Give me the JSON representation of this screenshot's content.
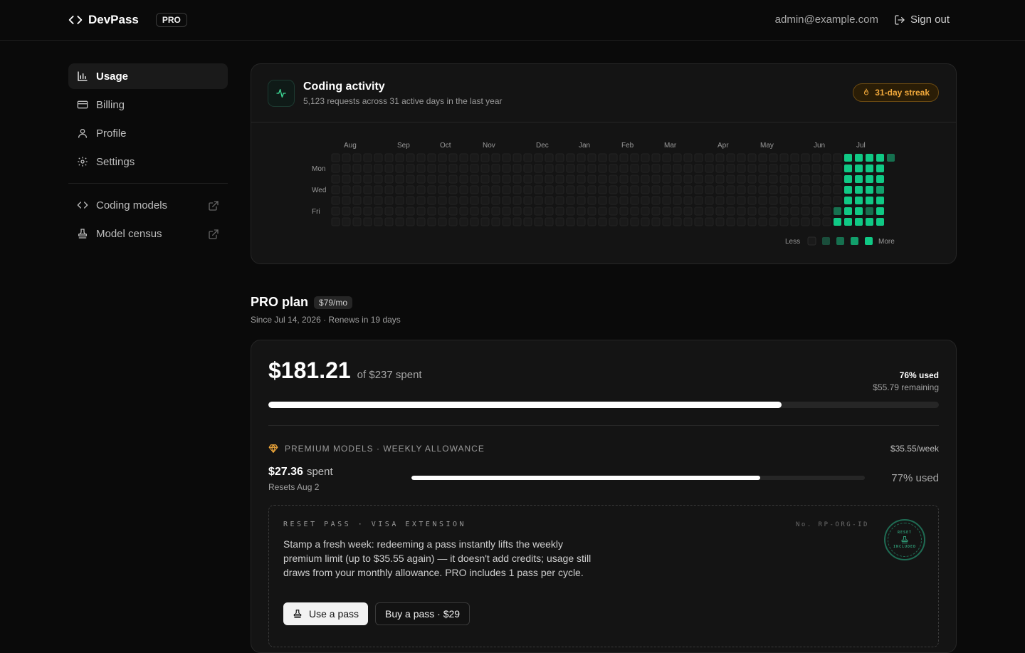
{
  "header": {
    "brand": "DevPass",
    "badge": "PRO",
    "email": "admin@example.com",
    "signout_label": "Sign out"
  },
  "sidebar": {
    "items": [
      {
        "label": "Usage",
        "icon": "bar-chart-icon",
        "active": true
      },
      {
        "label": "Billing",
        "icon": "credit-card-icon"
      },
      {
        "label": "Profile",
        "icon": "user-icon"
      },
      {
        "label": "Settings",
        "icon": "gear-icon"
      }
    ],
    "external": [
      {
        "label": "Coding models",
        "icon": "code-icon"
      },
      {
        "label": "Model census",
        "icon": "stamp-icon"
      }
    ]
  },
  "activity": {
    "title": "Coding activity",
    "subtitle": "5,123 requests across 31 active days in the last year",
    "streak": "31-day streak",
    "months": [
      "Aug",
      "Sep",
      "Oct",
      "Nov",
      "Dec",
      "Jan",
      "Feb",
      "Mar",
      "Apr",
      "May",
      "Jun",
      "Jul"
    ],
    "days": [
      "Mon",
      "Wed",
      "Fri"
    ],
    "legend_less": "Less",
    "legend_more": "More",
    "colors": {
      "empty": "#1a1a1a",
      "l1": "#1a4d3b",
      "l2": "#16704f",
      "l3": "#12a06c",
      "l4": "#10c985",
      "accent": "#3ddc97"
    }
  },
  "plan": {
    "title": "PRO plan",
    "price": "$79/mo",
    "subtitle": "Since Jul 14, 2026 · Renews in 19 days"
  },
  "spend": {
    "amount": "$181.21",
    "of_text": "of $237 spent",
    "used_pct_label": "76% used",
    "remaining": "$55.79 remaining",
    "used_fraction": 0.765
  },
  "premium": {
    "label": "PREMIUM MODELS · WEEKLY ALLOWANCE",
    "rate": "$35.55/week",
    "spent_value": "$27.36",
    "spent_word": "spent",
    "resets": "Resets Aug 2",
    "used_label": "77% used",
    "used_fraction": 0.77
  },
  "pass": {
    "heading": "RESET PASS · VISA EXTENSION",
    "number": "No. RP-ORG-ID",
    "text": "Stamp a fresh week: redeeming a pass instantly lifts the weekly premium limit (up to $35.55 again) — it doesn't add credits; usage still draws from your monthly allowance. PRO includes 1 pass per cycle.",
    "stamp_top": "RESET",
    "stamp_bottom": "INCLUDED",
    "use_label": "Use a pass",
    "buy_label": "Buy a pass · $29"
  }
}
